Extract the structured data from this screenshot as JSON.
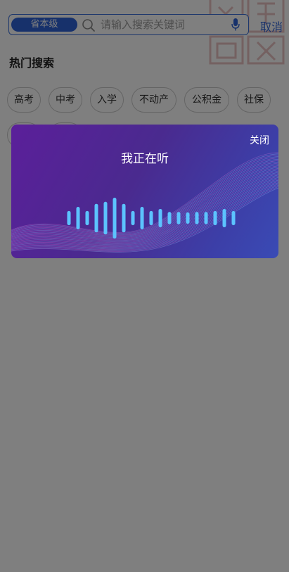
{
  "search": {
    "region_label": "省本级",
    "placeholder": "请输入搜索关键词",
    "cancel_label": "取消"
  },
  "hot_search": {
    "title": "热门搜索",
    "tags": [
      "高考",
      "中考",
      "入学",
      "不动产",
      "公积金",
      "社保",
      "",
      ""
    ]
  },
  "voice_dialog": {
    "close_label": "关闭",
    "status": "我正在听",
    "bar_levels": [
      0.35,
      0.55,
      0.35,
      0.7,
      0.8,
      1.0,
      0.7,
      0.35,
      0.55,
      0.35,
      0.45,
      0.3,
      0.3,
      0.28,
      0.3,
      0.3,
      0.35,
      0.45,
      0.35
    ],
    "bar_color": "#5cc3ff"
  },
  "colors": {
    "accent": "#2f63d6",
    "overlay": "rgba(0,0,0,0.5)"
  }
}
